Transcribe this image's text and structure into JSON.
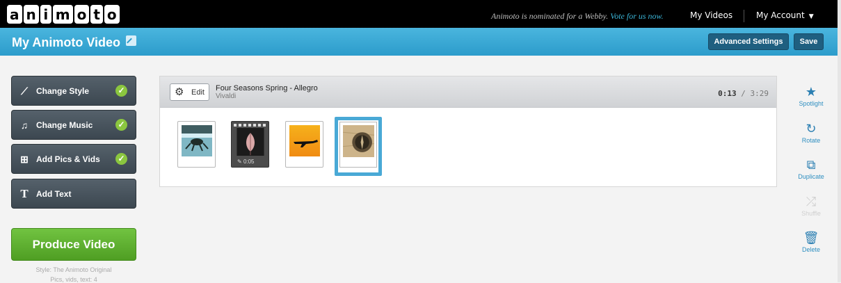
{
  "app": {
    "logo_letters": [
      "a",
      "n",
      "i",
      "m",
      "o",
      "t",
      "o"
    ],
    "promo_text": "Animoto is nominated for a Webby.",
    "promo_link": "Vote for us now.",
    "nav": {
      "my_videos": "My Videos",
      "my_account": "My Account"
    }
  },
  "header": {
    "title": "My Animoto Video",
    "advanced_settings": "Advanced Settings",
    "save": "Save"
  },
  "sidebar": {
    "items": [
      {
        "label": "Change Style",
        "done": true,
        "icon": "brush-icon"
      },
      {
        "label": "Change Music",
        "done": true,
        "icon": "music-note-icon"
      },
      {
        "label": "Add Pics & Vids",
        "done": true,
        "icon": "add-media-icon"
      },
      {
        "label": "Add Text",
        "done": false,
        "icon": "text-icon"
      }
    ],
    "produce": "Produce Video",
    "style_info": "Style: The Animoto Original",
    "pics_info": "Pics, vids, text: 4"
  },
  "timeline": {
    "edit_label": "Edit",
    "song_title": "Four Seasons Spring - Allegro",
    "artist": "Vivaldi",
    "duration_current": "0:13",
    "duration_total": " / 3:29",
    "items": [
      {
        "type": "image",
        "name": "frog"
      },
      {
        "type": "video",
        "name": "leaf",
        "duration": "0:05"
      },
      {
        "type": "image",
        "name": "plane"
      },
      {
        "type": "image",
        "name": "compass",
        "selected": true
      }
    ]
  },
  "tools": {
    "spotlight": "Spotlight",
    "rotate": "Rotate",
    "duplicate": "Duplicate",
    "shuffle": "Shuffle",
    "delete": "Delete"
  },
  "colors": {
    "header_blue": "#2c9ccb",
    "produce_green": "#5eb02d",
    "check_green": "#8bc63f",
    "selected_blue": "#49a9d6"
  }
}
